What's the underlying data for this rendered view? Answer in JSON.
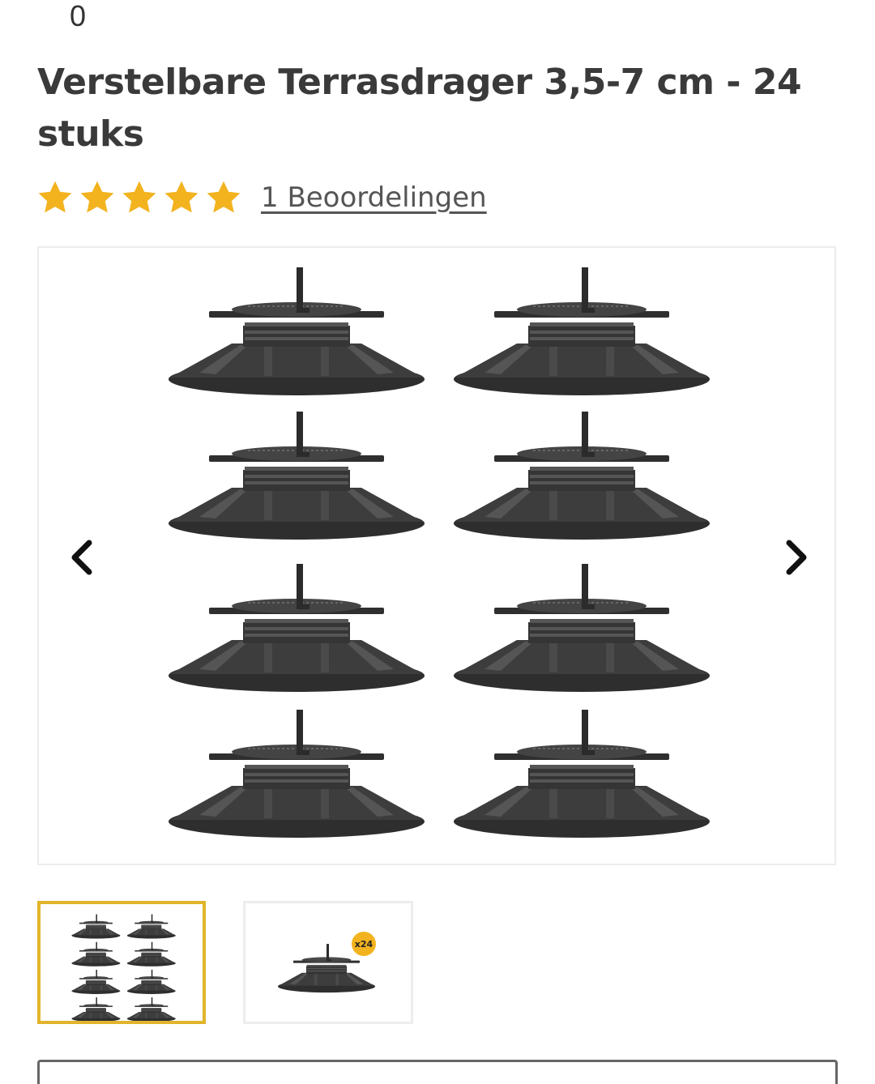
{
  "header": {
    "cart_count": "0"
  },
  "product": {
    "title": "Verstelbare Terrasdrager 3,5-7 cm - 24 stuks",
    "rating": 5,
    "rating_max": 5,
    "reviews_link": "1 Beoordelingen"
  },
  "gallery": {
    "thumbnails": [
      {
        "badge": ""
      },
      {
        "badge": "x24"
      }
    ],
    "selected_index": 0
  },
  "colors": {
    "star": "#f2b31f",
    "accent": "#e1b52b",
    "product": "#3b3b3b"
  },
  "icons": {
    "prev": "chevron-left-icon",
    "next": "chevron-right-icon",
    "rating": "star-icon"
  }
}
